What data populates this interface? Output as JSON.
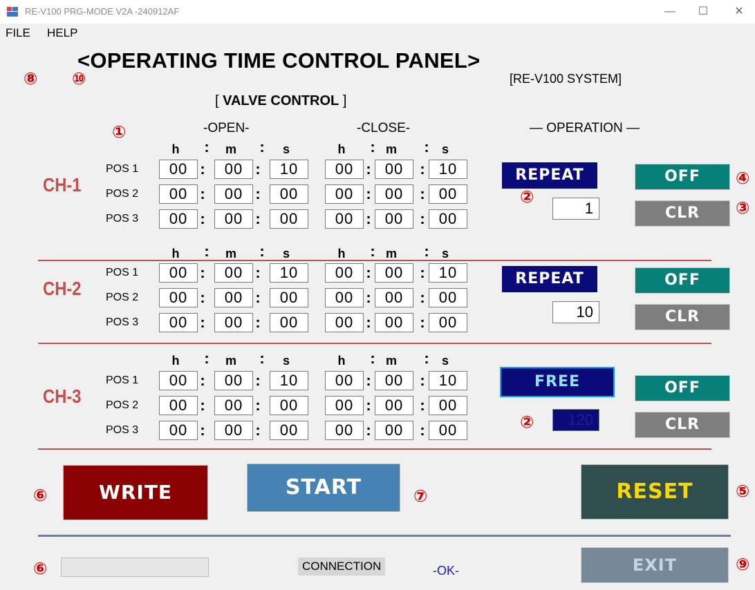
{
  "window": {
    "title": "RE-V100 PRG-MODE  V2A -240912AF"
  },
  "menu": {
    "items": [
      "FILE",
      "HELP"
    ]
  },
  "panel": {
    "heading": "<OPERATING TIME  CONTROL PANEL>",
    "system": "[RE-V100 SYSTEM]",
    "section_open": "[ ",
    "section_title": "VALVE CONTROL",
    "section_close": " ]"
  },
  "headers": {
    "open": "-OPEN-",
    "close": "-CLOSE-",
    "operation": "— OPERATION —"
  },
  "units": {
    "h": "h",
    "m": "m",
    "s": "s",
    "colon": ":"
  },
  "callouts": {
    "c1": "①",
    "c2": "②",
    "c3": "③",
    "c4": "④",
    "c5": "⑤",
    "c6": "⑥",
    "c7": "⑦",
    "c8": "⑧",
    "c9": "⑨",
    "c10": "⑩"
  },
  "channels": [
    {
      "label": "CH-1",
      "positions": [
        {
          "label": "POS 1",
          "open": [
            "00",
            "00",
            "10"
          ],
          "close": [
            "00",
            "00",
            "10"
          ]
        },
        {
          "label": "POS 2",
          "open": [
            "00",
            "00",
            "00"
          ],
          "close": [
            "00",
            "00",
            "00"
          ]
        },
        {
          "label": "POS 3",
          "open": [
            "00",
            "00",
            "00"
          ],
          "close": [
            "00",
            "00",
            "00"
          ]
        }
      ],
      "mode": "REPEAT",
      "count": "1",
      "off": "OFF",
      "clr": "CLR"
    },
    {
      "label": "CH-2",
      "positions": [
        {
          "label": "POS 1",
          "open": [
            "00",
            "00",
            "10"
          ],
          "close": [
            "00",
            "00",
            "10"
          ]
        },
        {
          "label": "POS 2",
          "open": [
            "00",
            "00",
            "00"
          ],
          "close": [
            "00",
            "00",
            "00"
          ]
        },
        {
          "label": "POS 3",
          "open": [
            "00",
            "00",
            "00"
          ],
          "close": [
            "00",
            "00",
            "00"
          ]
        }
      ],
      "mode": "REPEAT",
      "count": "10",
      "off": "OFF",
      "clr": "CLR"
    },
    {
      "label": "CH-3",
      "positions": [
        {
          "label": "POS 1",
          "open": [
            "00",
            "00",
            "10"
          ],
          "close": [
            "00",
            "00",
            "10"
          ]
        },
        {
          "label": "POS 2",
          "open": [
            "00",
            "00",
            "00"
          ],
          "close": [
            "00",
            "00",
            "00"
          ]
        },
        {
          "label": "POS 3",
          "open": [
            "00",
            "00",
            "00"
          ],
          "close": [
            "00",
            "00",
            "00"
          ]
        }
      ],
      "mode": "FREE",
      "count": "120",
      "off": "OFF",
      "clr": "CLR"
    }
  ],
  "actions": {
    "write": "WRITE",
    "start": "START",
    "reset": "RESET",
    "exit": "EXIT"
  },
  "status": {
    "connection_label": "CONNECTION",
    "connection_value": "-OK-"
  },
  "colors": {
    "channel_label": "#c0504d",
    "repeat": "#0a0a78",
    "off": "#08807a",
    "clr": "#7e7e7e",
    "write": "#8b0000",
    "start": "#4682b4",
    "reset": "#2f4f4f",
    "reset_text": "#ffd700",
    "exit": "#778899",
    "callout": "#d00000",
    "status_ok": "#1a1ad6"
  }
}
